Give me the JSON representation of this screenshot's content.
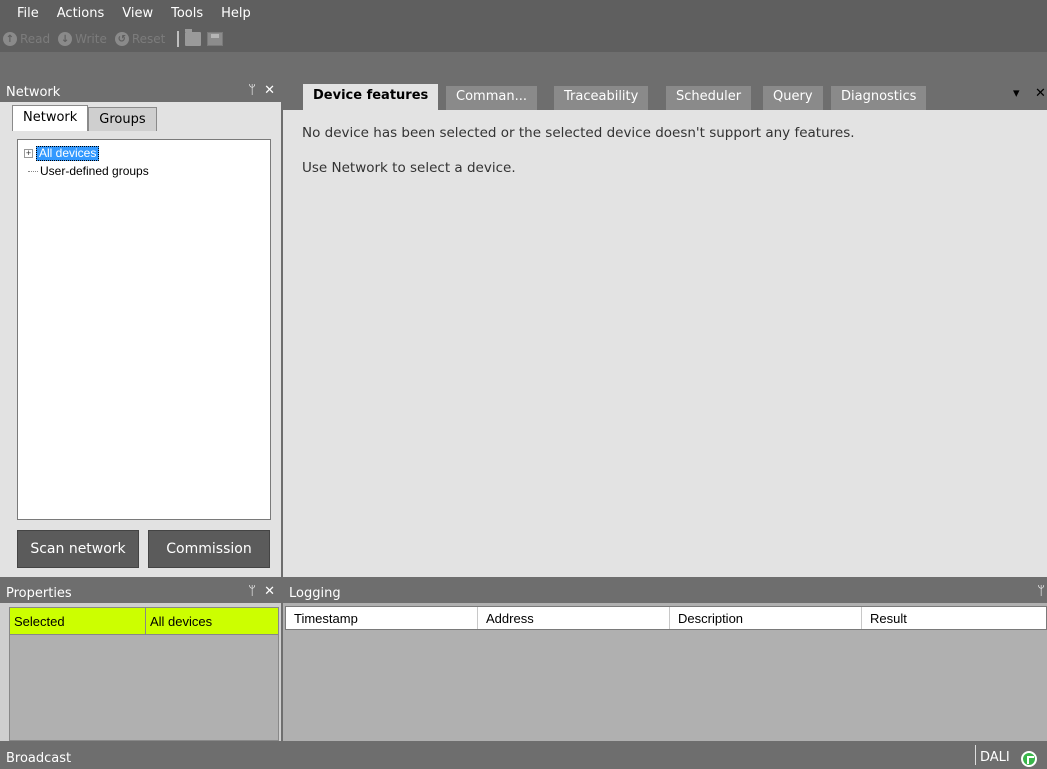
{
  "menu": [
    "File",
    "Actions",
    "View",
    "Tools",
    "Help"
  ],
  "toolbar": {
    "read_label": "Read",
    "write_label": "Write",
    "reset_label": "Reset"
  },
  "network_pane": {
    "title": "Network",
    "pin": "Ͱ",
    "close": "✕",
    "tabs": [
      "Network",
      "Groups"
    ],
    "tree": {
      "expander": "+",
      "items": [
        "All devices",
        "User-defined groups"
      ]
    },
    "scan_button": "Scan network",
    "commission_button": "Commission"
  },
  "feature_pane": {
    "tabs": [
      "Device features",
      "Comman...",
      "Traceability",
      "Scheduler",
      "Query",
      "Diagnostics"
    ],
    "message_1": "No device has been selected or the selected device doesn't support any features.",
    "message_2": "Use Network to select a device."
  },
  "properties_pane": {
    "title": "Properties",
    "pin": "Ͱ",
    "close": "✕",
    "row_key": "Selected",
    "row_value": "All devices",
    "highlight_color": "#ccff00"
  },
  "logging_pane": {
    "title": "Logging",
    "pin": "Ͱ",
    "columns": [
      "Timestamp",
      "Address",
      "Description",
      "Result"
    ]
  },
  "status": {
    "left": "Broadcast",
    "right": "DALI"
  }
}
